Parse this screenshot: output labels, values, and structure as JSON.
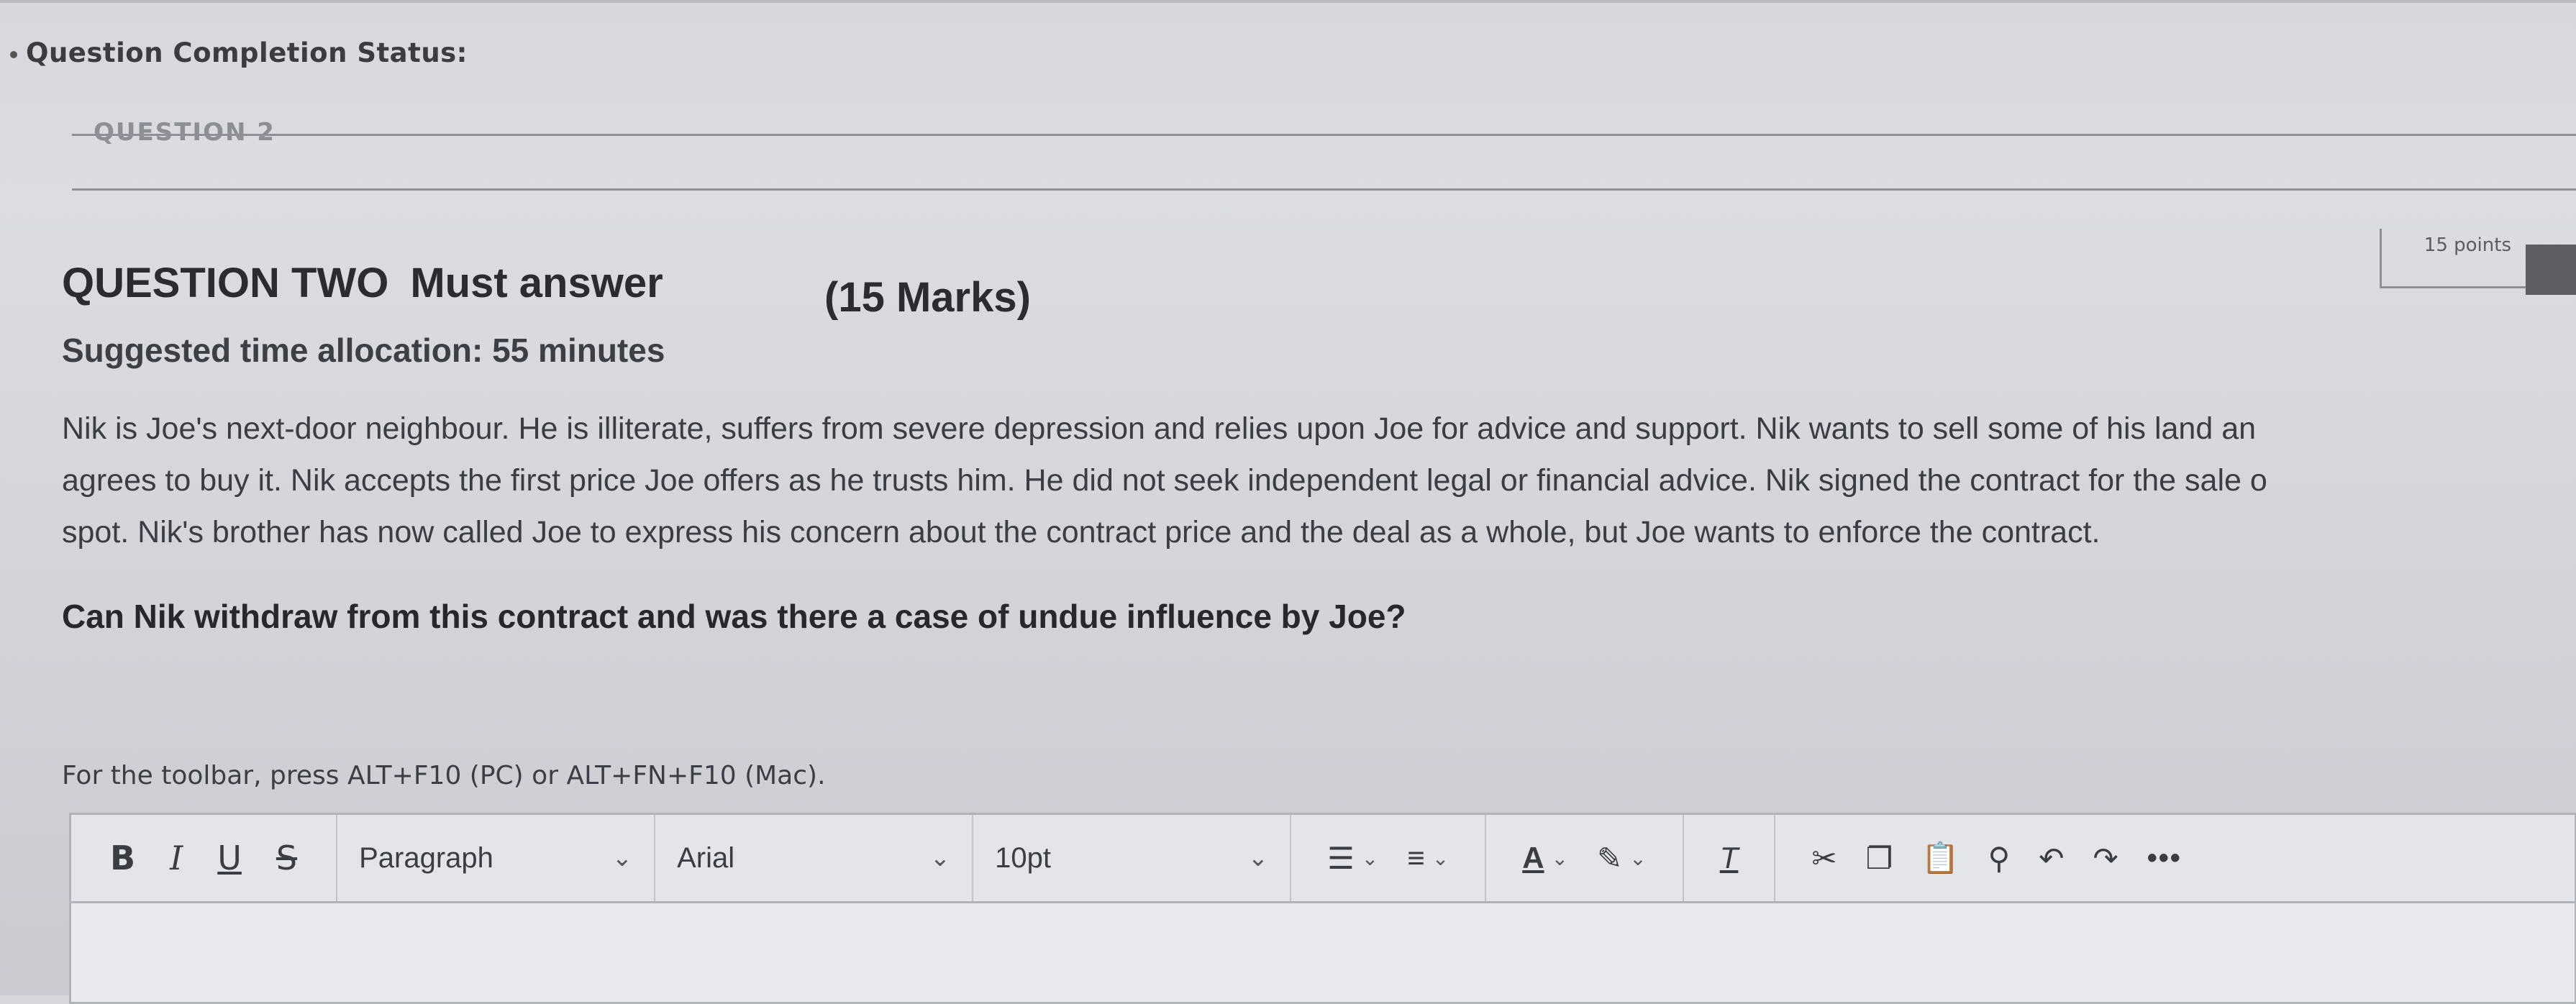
{
  "page": {
    "completion_status_label": "Question Completion Status:",
    "section_heading": "QUESTION 2",
    "points": "15 points"
  },
  "question": {
    "title": "QUESTION TWO",
    "must_answer": "Must answer",
    "marks": "(15 Marks)",
    "time_allocation": "Suggested time allocation: 55 minutes",
    "body_lines": [
      "Nik is Joe's next-door neighbour. He is illiterate, suffers from severe depression and relies upon Joe for advice and support. Nik wants to sell some of his land an",
      "agrees to buy it. Nik accepts the first price Joe offers as he trusts him. He did not seek independent legal or financial advice. Nik signed the contract for the sale o",
      "spot. Nik's brother has now called Joe to express his concern about the contract price and the deal as a whole, but Joe wants to enforce the contract."
    ],
    "prompt": "Can Nik withdraw from this contract and was there a case of undue influence by Joe?"
  },
  "editor": {
    "toolbar_hint": "For the toolbar, press ALT+F10 (PC) or ALT+FN+F10 (Mac).",
    "bold": "B",
    "italic": "I",
    "underline": "U",
    "strike": "S",
    "paragraph": "Paragraph",
    "font": "Arial",
    "size": "10pt",
    "more": "•••"
  },
  "icons": [
    "chevron-down-icon",
    "bullet-list-icon",
    "numbered-list-icon",
    "text-color-icon",
    "highlight-icon",
    "clear-format-icon",
    "cut-icon",
    "copy-icon",
    "paste-icon",
    "search-icon",
    "undo-icon",
    "redo-icon",
    "more-icon"
  ]
}
